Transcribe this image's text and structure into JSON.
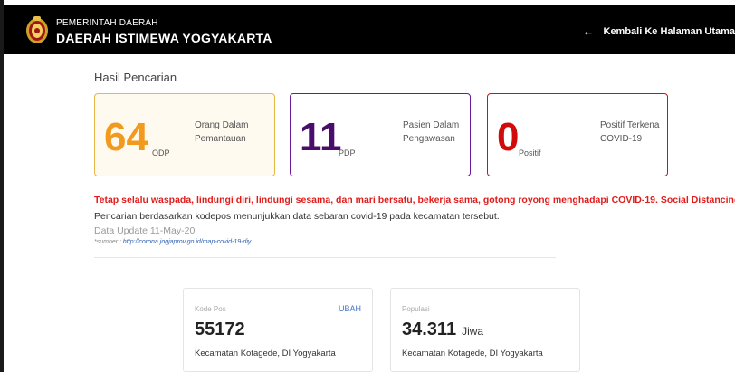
{
  "header": {
    "line1": "PEMERINTAH DAERAH",
    "line2": "DAERAH ISTIMEWA YOGYAKARTA",
    "back_label": "Kembali Ke Halaman Utama",
    "back_arrow": "←"
  },
  "section_title": "Hasil Pencarian",
  "cards": [
    {
      "value": "64",
      "abbr": "ODP",
      "desc": "Orang Dalam Pemantauan",
      "color": "#f29a1e"
    },
    {
      "value": "11",
      "abbr": "PDP",
      "desc": "Pasien Dalam Pengawasan",
      "color": "#4a0d6b"
    },
    {
      "value": "0",
      "abbr": "Positif",
      "desc": "Positif Terkena COVID-19",
      "color": "#d10b0b"
    }
  ],
  "alert_text": "Tetap selalu waspada, lindungi diri, lindungi sesama, dan mari bersatu, bekerja sama, gotong royong menghadapi COVID-19. Social Distancing !",
  "info_text": "Pencarian berdasarkan kodepos menunjukkan data sebaran covid-19 pada kecamatan tersebut.",
  "update_text": "Data Update 11-May-20",
  "source": {
    "prefix": "*sumber : ",
    "link": "http://corona.jogjaprov.go.id/map-covid-19-diy"
  },
  "kodepos": {
    "label": "Kode Pos",
    "action": "UBAH",
    "value": "55172",
    "sub": "Kecamatan Kotagede, DI Yogyakarta"
  },
  "populasi": {
    "label": "Populasi",
    "value": "34.311",
    "unit": "Jiwa",
    "sub": "Kecamatan Kotagede, DI Yogyakarta"
  }
}
